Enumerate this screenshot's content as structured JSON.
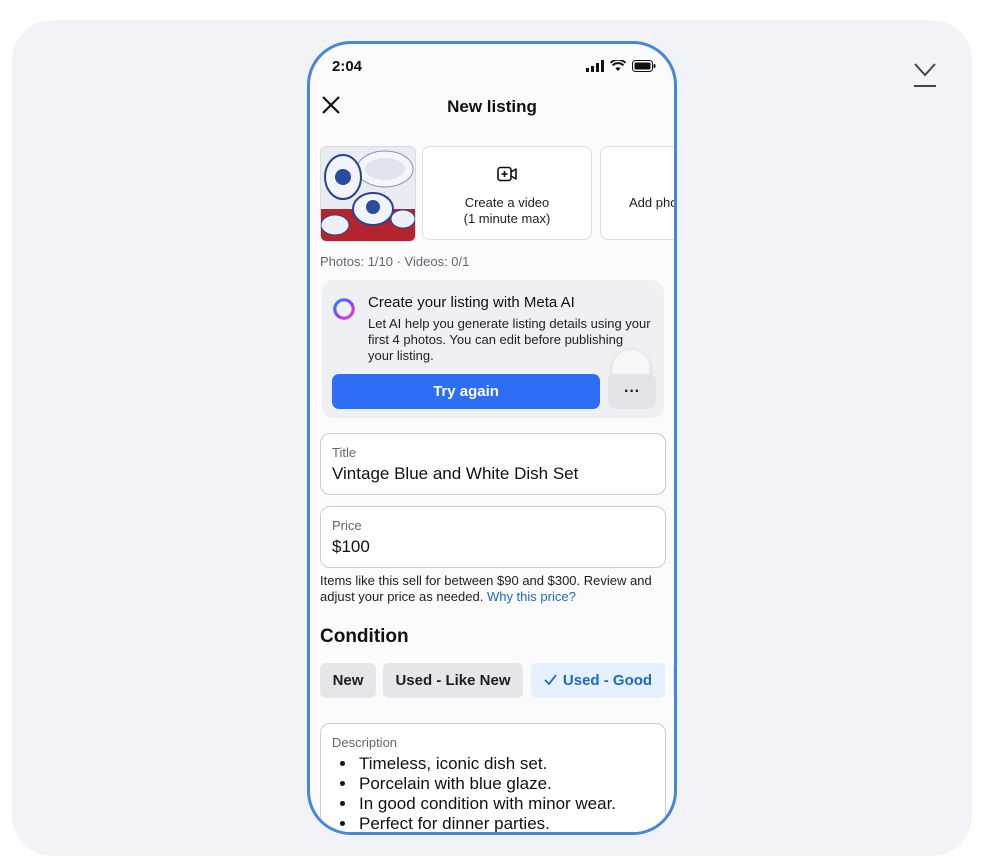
{
  "status_bar": {
    "time": "2:04"
  },
  "header": {
    "title": "New listing"
  },
  "media": {
    "video_tile_label": "Create a video\n(1 minute max)",
    "photo_tile_label": "Add photos",
    "count_text": "Photos: 1/10 · Videos: 0/1"
  },
  "ai_card": {
    "title": "Create your listing with Meta AI",
    "body": "Let AI help you generate listing details using your first 4 photos. You can edit before publishing your listing.",
    "try_again_label": "Try again",
    "more_label": "···"
  },
  "title_field": {
    "label": "Title",
    "value": "Vintage Blue and White Dish Set"
  },
  "price_field": {
    "label": "Price",
    "value": "$100"
  },
  "price_hint": {
    "text": "Items like this sell for between $90 and $300. Review and adjust your price as needed. ",
    "link": "Why this price?"
  },
  "condition": {
    "title": "Condition",
    "options": [
      "New",
      "Used - Like New",
      "Used - Good"
    ],
    "selected": "Used - Good"
  },
  "description": {
    "label": "Description",
    "items": [
      "Timeless, iconic dish set.",
      "Porcelain with blue glaze.",
      "In good condition with minor wear.",
      "Perfect for dinner parties."
    ]
  },
  "colors": {
    "accent": "#2d6ef5",
    "link": "#1b6ac9",
    "frame": "#4a86d6"
  },
  "icons": [
    "download-icon",
    "signal-icon",
    "wifi-icon",
    "battery-icon",
    "close-icon",
    "video-add-icon",
    "meta-ai-ring-icon",
    "checkmark-icon"
  ]
}
